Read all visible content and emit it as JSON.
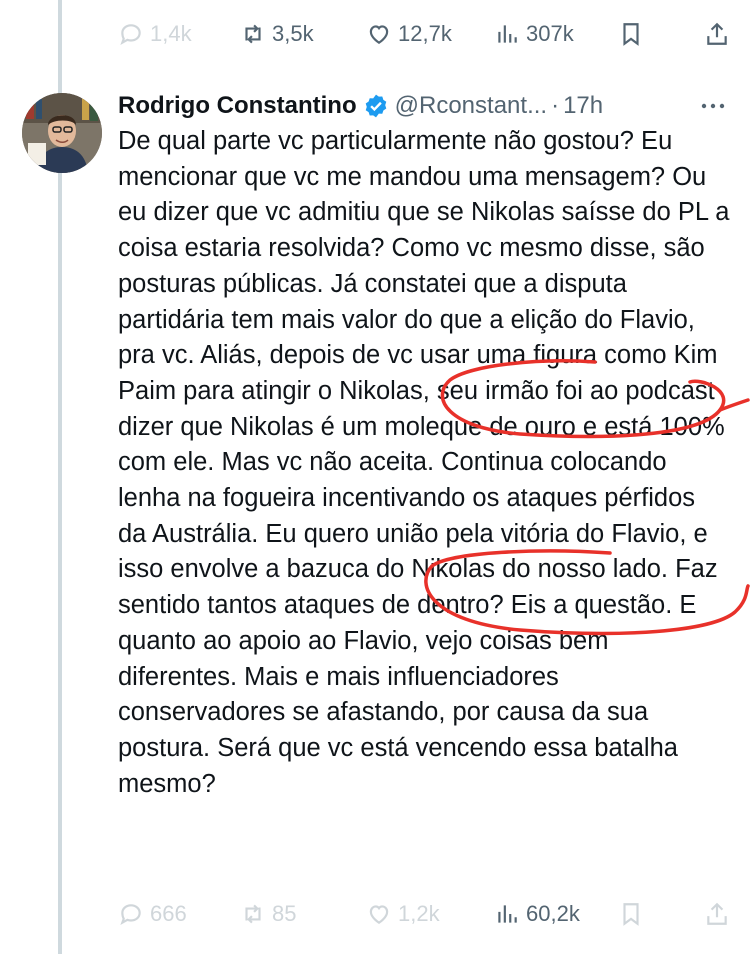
{
  "previous_tweet_actions": {
    "replies": "1,4k",
    "retweets": "3,5k",
    "likes": "12,7k",
    "views": "307k"
  },
  "tweet": {
    "author_name": "Rodrigo Constantino",
    "handle": "@Rconstant...",
    "separator": "·",
    "time": "17h",
    "text": "De qual parte vc particularmente não gostou? Eu mencionar que vc me mandou uma mensagem? Ou eu dizer que vc admitiu que se Nikolas saísse do PL a coisa estaria resolvida? Como vc mesmo disse, são posturas públicas. Já constatei que a disputa partidária tem mais valor do que a elição do Flavio, pra vc. Aliás, depois de vc usar uma figura como Kim Paim para atingir o Nikolas, seu irmão foi ao podcast dizer que Nikolas é um moleque de ouro e está 100% com ele. Mas vc não aceita. Continua colocando lenha na fogueira incentivando os ataques pérfidos da Austrália. Eu quero união pela vitória do Flavio, e isso envolve a bazuca do Nikolas do nosso lado. Faz sentido tantos ataques de dentro? Eis a questão. E quanto ao apoio ao Flavio, vejo coisas bem diferentes. Mais e mais influenciadores conservadores se afastando, por causa da sua postura. Será que vc está vencendo essa batalha mesmo?",
    "actions": {
      "replies": "666",
      "retweets": "85",
      "likes": "1,2k",
      "views": "60,2k"
    }
  },
  "colors": {
    "text": "#0f1419",
    "secondary": "#536471",
    "faded": "#d0d6da",
    "verified": "#1d9bf0",
    "annotation": "#e8312a",
    "thread_line": "#cfd9de"
  },
  "icons": [
    "reply-icon",
    "retweet-icon",
    "like-icon",
    "views-icon",
    "bookmark-icon",
    "share-icon",
    "verified-badge-icon",
    "more-icon"
  ]
}
